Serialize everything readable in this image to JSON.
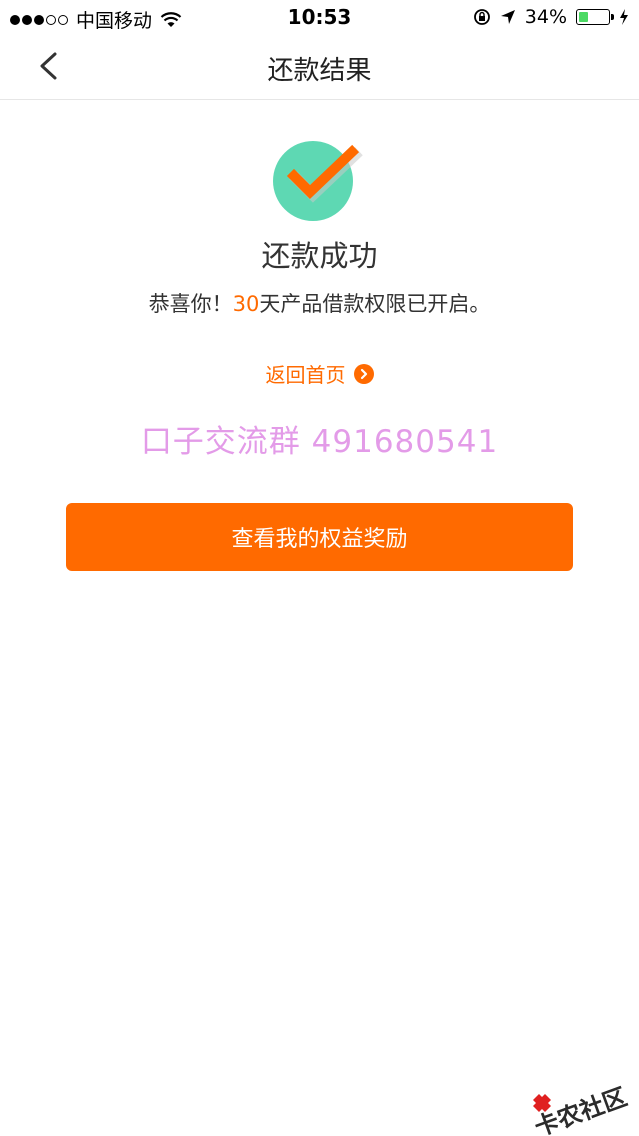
{
  "status_bar": {
    "carrier": "中国移动",
    "time": "10:53",
    "battery_percent": "34%",
    "battery_level": 0.34,
    "battery_color": "#4cd964"
  },
  "nav": {
    "title": "还款结果",
    "back_icon": "chevron-left-icon"
  },
  "result": {
    "icon": "checkmark-circle-icon",
    "title": "还款成功",
    "desc_prefix": "恭喜你！",
    "desc_days": "30",
    "desc_suffix": "天产品借款权限已开启。",
    "home_link": "返回首页",
    "home_link_icon": "arrow-right-circle-icon"
  },
  "watermark": {
    "text": "口子交流群 491680541"
  },
  "button": {
    "label": "查看我的权益奖励"
  },
  "corner_logo": {
    "text": "卡农社区"
  },
  "colors": {
    "accent": "#ff6a00",
    "success_circle": "#5ed8b3",
    "watermark": "#e39be8"
  }
}
